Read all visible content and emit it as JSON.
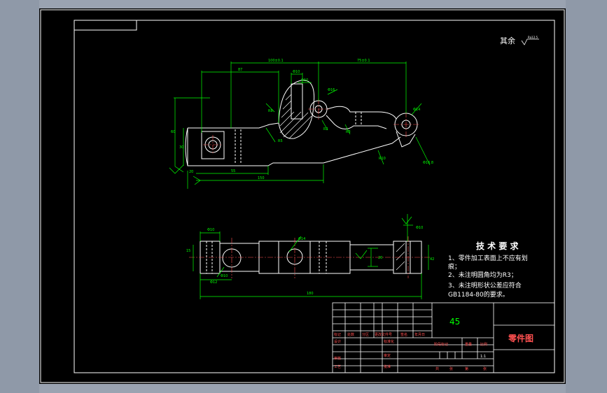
{
  "drawing": {
    "roughness_note": "其余",
    "roughness_symbol_value": "Ra12.5",
    "tech_requirements": {
      "title": "技 术 要 求",
      "items": [
        "1、零件加工表面上不应有划",
        "痕；",
        "2、未注明圆角均为R3；",
        "3、未注明形状公差应符合",
        "GB1184-80的要求。"
      ]
    },
    "title_block": {
      "material": "45",
      "part_name": "零件图",
      "scale": "1:1",
      "labels_row1": [
        "标记",
        "处数",
        "分区",
        "更改文件号",
        "签名",
        "年月日"
      ],
      "labels_left": [
        "设计",
        "审核",
        "工艺"
      ],
      "labels_mid": [
        "标准化",
        "审定",
        "批准"
      ],
      "labels_right": [
        "阶段标记",
        "重量",
        "比例"
      ],
      "labels_bottom": [
        "共",
        "张",
        "第",
        "张"
      ]
    },
    "dimensions": {
      "top_view": [
        "100±0.1",
        "75±0.1",
        "87",
        "Φ10",
        "Φ10",
        "Φ16",
        "Φ14",
        "R2",
        "R3",
        "R8",
        "R5",
        "60",
        "30",
        "20",
        "55",
        "150",
        "Φ16.8",
        "R10"
      ],
      "bottom_view": [
        "Φ10",
        "Φ10",
        "Φ14",
        "Φ12",
        "15",
        "20",
        "42",
        "180",
        "Φ10"
      ]
    }
  }
}
